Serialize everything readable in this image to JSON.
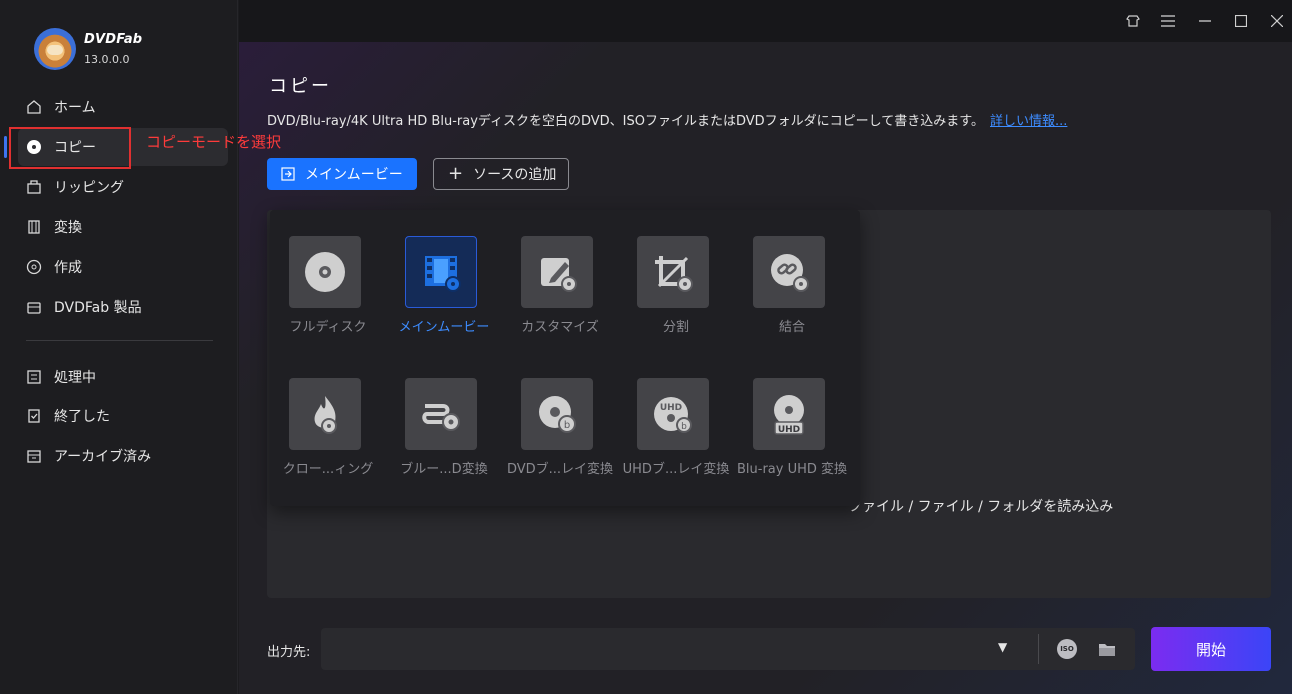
{
  "app": {
    "brand_name": "DVDFab",
    "version": "13.0.0.0"
  },
  "sidebar": {
    "items": [
      {
        "label": "ホーム",
        "icon": "home-icon"
      },
      {
        "label": "コピー",
        "icon": "disc-copy-icon",
        "active": true
      },
      {
        "label": "リッピング",
        "icon": "ripping-icon"
      },
      {
        "label": "変換",
        "icon": "film-convert-icon"
      },
      {
        "label": "作成",
        "icon": "disc-create-icon"
      },
      {
        "label": "DVDFab 製品",
        "icon": "products-icon"
      }
    ],
    "tasks": [
      {
        "label": "処理中",
        "icon": "processing-icon"
      },
      {
        "label": "終了した",
        "icon": "finished-icon"
      },
      {
        "label": "アーカイブ済み",
        "icon": "archive-icon"
      }
    ]
  },
  "annotation": {
    "text": "コピーモードを選択"
  },
  "main": {
    "title": "コピー",
    "description": "DVD/Blu-ray/4K Ultra HD Blu-rayディスクを空白のDVD、ISOファイルまたはDVDフォルダにコピーして書き込みます。",
    "more_link": "詳しい情報...",
    "mode_button": "メインムービー",
    "add_source_button": "ソースの追加",
    "drop_hint": "ファイル / ファイル / フォルダを読み込み"
  },
  "modes": [
    {
      "label": "フルディスク",
      "icon": "full-disc-icon"
    },
    {
      "label": "メインムービー",
      "icon": "main-movie-icon",
      "selected": true
    },
    {
      "label": "カスタマイズ",
      "icon": "customize-icon"
    },
    {
      "label": "分割",
      "icon": "split-icon"
    },
    {
      "label": "結合",
      "icon": "merge-icon"
    },
    {
      "label": "クロー...ィング",
      "icon": "clone-burn-icon"
    },
    {
      "label": "ブルー...D変換",
      "icon": "bluray-to-dvd-icon"
    },
    {
      "label": "DVDブ...レイ変換",
      "icon": "dvd-to-bluray-icon"
    },
    {
      "label": "UHDブ...レイ変換",
      "icon": "uhd-to-bluray-icon"
    },
    {
      "label": "Blu-ray UHD 変換",
      "icon": "bluray-to-uhd-icon"
    }
  ],
  "bottom": {
    "output_label": "出力先:",
    "iso_label": "ISO",
    "start_button": "開始"
  },
  "colors": {
    "accent": "#1a73ff",
    "annotation": "#ff3b3b",
    "start_gradient_from": "#7b2cf0",
    "start_gradient_to": "#3b45f7"
  }
}
